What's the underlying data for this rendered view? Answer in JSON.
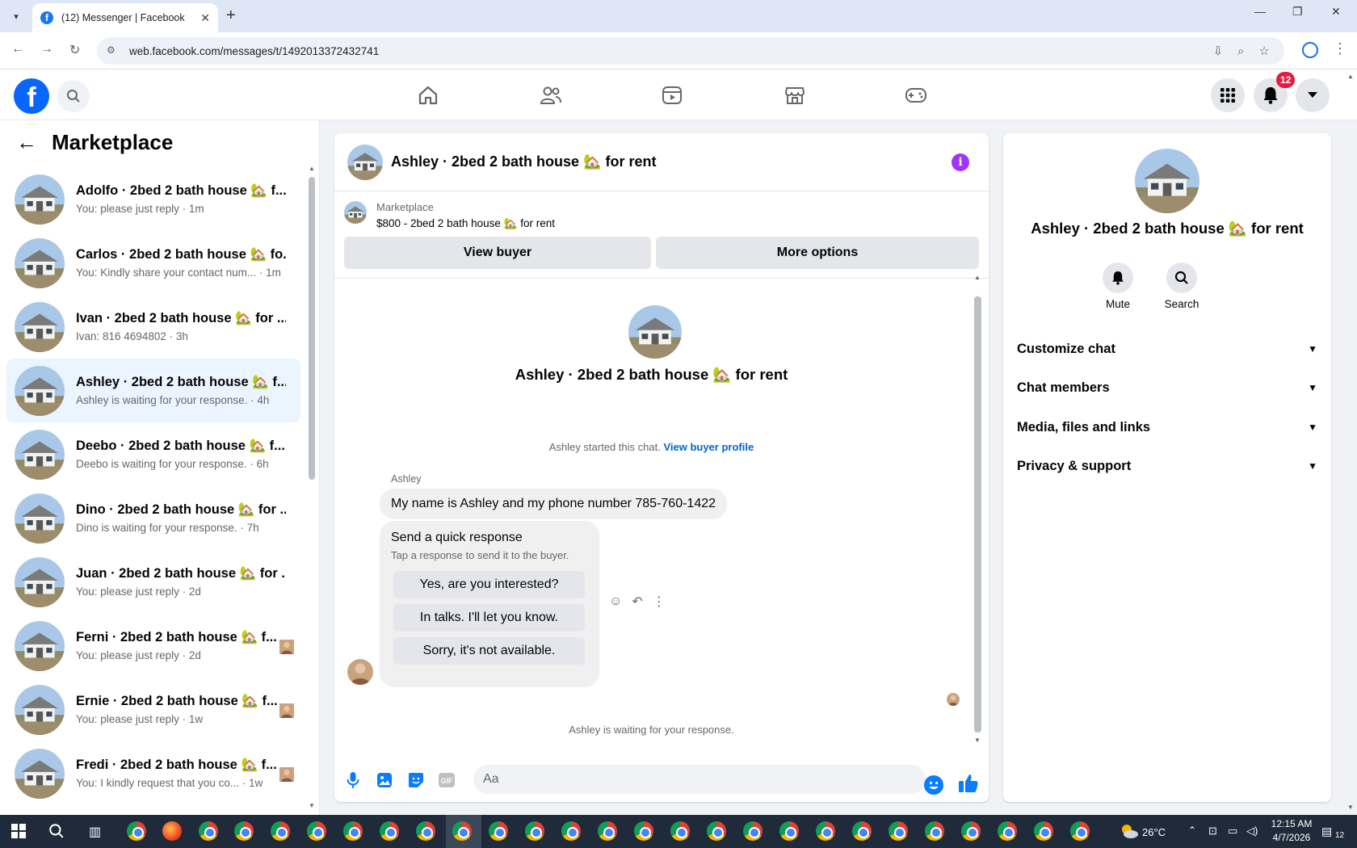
{
  "browser": {
    "tab_title": "(12) Messenger | Facebook",
    "url": "web.facebook.com/messages/t/1492013372432741"
  },
  "fbnav": {
    "notification_count": "12"
  },
  "sidebar": {
    "title": "Marketplace",
    "conversations": [
      {
        "name": "Adolfo · 2bed 2 bath house 🏡 f...",
        "preview": "You: please just reply · 1m",
        "has_receipt": false
      },
      {
        "name": "Carlos · 2bed 2 bath house 🏡 fo...",
        "preview": "You: Kindly share your contact num... · 1m",
        "has_receipt": false
      },
      {
        "name": "Ivan · 2bed 2 bath house 🏡 for ...",
        "preview": "Ivan: 816 4694802 · 3h",
        "has_receipt": false
      },
      {
        "name": "Ashley · 2bed 2 bath house 🏡 f...",
        "preview": "Ashley is waiting for your response. · 4h",
        "has_receipt": false,
        "active": true
      },
      {
        "name": "Deebo · 2bed 2 bath house 🏡 f...",
        "preview": "Deebo is waiting for your response. · 6h",
        "has_receipt": false
      },
      {
        "name": "Dino · 2bed 2 bath house 🏡 for ...",
        "preview": "Dino is waiting for your response. · 7h",
        "has_receipt": false
      },
      {
        "name": "Juan · 2bed 2 bath house 🏡 for ...",
        "preview": "You: please just reply · 2d",
        "has_receipt": false
      },
      {
        "name": "Ferni · 2bed 2 bath house 🏡 f...",
        "preview": "You: please just reply · 2d",
        "has_receipt": true
      },
      {
        "name": "Ernie · 2bed 2 bath house 🏡 f...",
        "preview": "You: please just reply · 1w",
        "has_receipt": true
      },
      {
        "name": "Fredi · 2bed 2 bath house 🏡 f...",
        "preview": "You: I kindly request that you co... · 1w",
        "has_receipt": true
      }
    ]
  },
  "chat": {
    "header_title": "Ashley · 2bed 2 bath house 🏡 for rent",
    "banner_label": "Marketplace",
    "banner_listing": "$800 - 2bed 2 bath house 🏡 for rent",
    "view_buyer": "View buyer",
    "more_options": "More options",
    "intro_name": "Ashley · 2bed 2 bath house 🏡 for rent",
    "started_text": "Ashley started this chat.",
    "view_profile": "View buyer profile",
    "sender": "Ashley",
    "message": "My name is Ashley and my phone number 785-760-1422",
    "quick_title": "Send a quick response",
    "quick_subtitle": "Tap a response to send it to the buyer.",
    "quick_replies": [
      "Yes, are you interested?",
      "In talks. I'll let you know.",
      "Sorry, it's not available."
    ],
    "waiting_text": "Ashley is waiting for your response.",
    "input_placeholder": "Aa"
  },
  "info": {
    "name": "Ashley · 2bed 2 bath house 🏡 for rent",
    "mute": "Mute",
    "search": "Search",
    "sections": [
      "Customize chat",
      "Chat members",
      "Media, files and links",
      "Privacy & support"
    ]
  },
  "taskbar": {
    "temperature": "26°C",
    "time": "12:15 AM",
    "date": "4/7/2026",
    "notif_count": "12"
  },
  "colors": {
    "facebook_blue": "#0866ff",
    "messenger_blue": "#0a7cff",
    "info_purple": "#a033ff",
    "badge_red": "#e41e3f",
    "active_conv_bg": "#ebf5ff"
  }
}
